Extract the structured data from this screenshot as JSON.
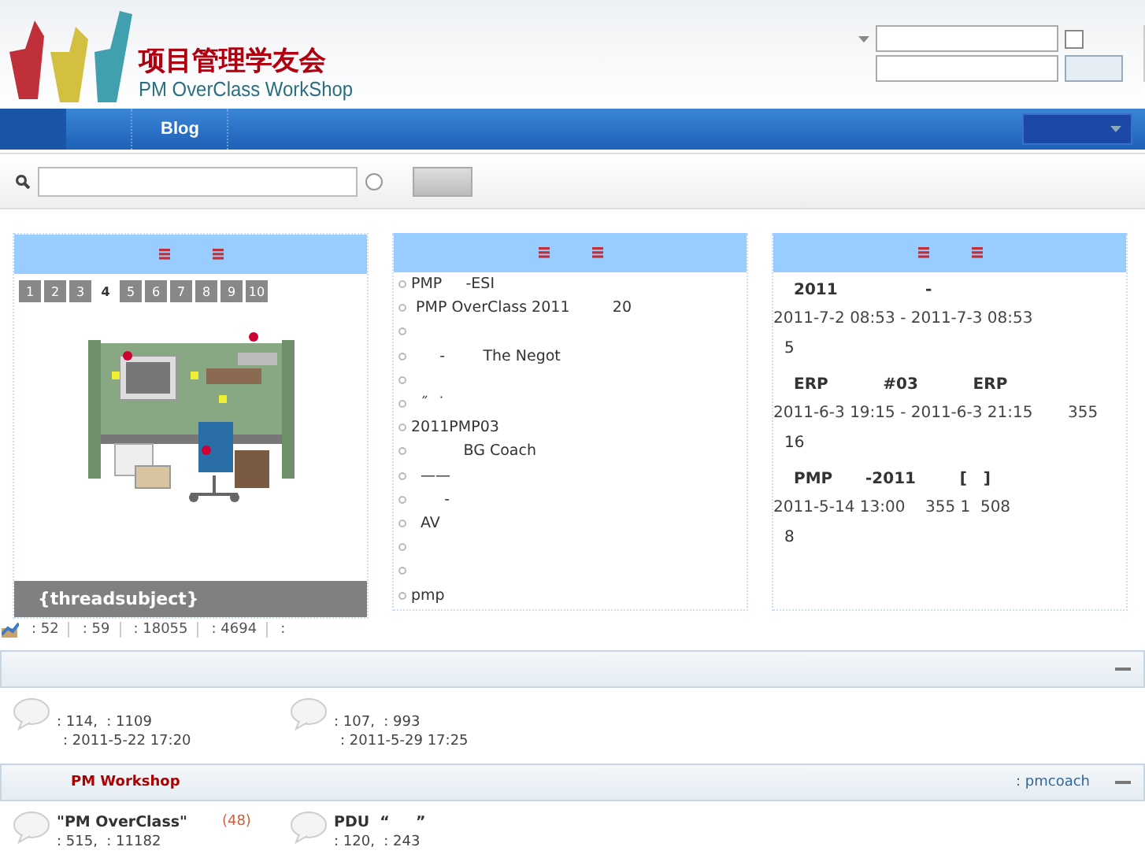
{
  "header": {
    "logo_title": "项目管理学友会",
    "logo_subtitle": "PM OverClass WorkShop",
    "remember": {
      "checked": false
    }
  },
  "nav": {
    "items": [
      {
        "label": "Blog",
        "selected": false
      }
    ]
  },
  "search": {
    "scope_radio": {
      "selected": false
    }
  },
  "featured": {
    "pages": [
      {
        "label": "1",
        "selected": false
      },
      {
        "label": "2",
        "selected": false
      },
      {
        "label": "3",
        "selected": false
      },
      {
        "label": "4",
        "selected": true
      },
      {
        "label": "5",
        "selected": false
      },
      {
        "label": "6",
        "selected": false
      },
      {
        "label": "7",
        "selected": false
      },
      {
        "label": "8",
        "selected": false
      },
      {
        "label": "9",
        "selected": false
      },
      {
        "label": "10",
        "selected": false
      }
    ],
    "caption": "{threadsubject}"
  },
  "stats": [
    ": 52",
    ": 59",
    ": 18055",
    ": 4694",
    ":"
  ],
  "threads": {
    "items": [
      {
        "kind": "text",
        "text": "PMP     -ESI"
      },
      {
        "kind": "text",
        "text": " PMP OverClass 2011         20"
      },
      {
        "kind": "empty"
      },
      {
        "kind": "text",
        "text": "      -        The Negot"
      },
      {
        "kind": "empty"
      },
      {
        "kind": "text",
        "text": "  ˝  ˙"
      },
      {
        "kind": "text",
        "text": "2011PMP03"
      },
      {
        "kind": "text",
        "text": "           BG Coach"
      },
      {
        "kind": "text",
        "text": "  ——"
      },
      {
        "kind": "text",
        "text": "       -"
      },
      {
        "kind": "text",
        "text": "  AV"
      },
      {
        "kind": "empty"
      },
      {
        "kind": "empty"
      },
      {
        "kind": "text",
        "text": "pmp"
      }
    ]
  },
  "events": [
    {
      "title": "2011                -",
      "time": "2011-7-2 08:53 - 2011-7-3 08:53",
      "count": "5"
    },
    {
      "title": "ERP          #03          ERP",
      "time": "2011-6-3 19:15 - 2011-6-3 21:15       355",
      "count": "16"
    },
    {
      "title": "PMP      -2011        [   ]",
      "time": "2011-5-14 13:00    355 1  508",
      "count": "8"
    }
  ],
  "sections": [
    {
      "collapsed": false,
      "forums": [
        {
          "stats": ": 114,  : 1109",
          "last_post": ": 2011-5-22 17:20"
        },
        {
          "stats": ": 107,  : 993",
          "last_post": ": 2011-5-29 17:25"
        }
      ]
    },
    {
      "title": "PM Workshop",
      "moderator": ": pmcoach",
      "collapsed": false,
      "forums": [
        {
          "name": "\"PM OverClass\"",
          "today": "(48)",
          "stats": ": 515,  : 11182"
        },
        {
          "name": "PDU  “     ”",
          "stats": ": 120,  : 243"
        }
      ]
    }
  ]
}
